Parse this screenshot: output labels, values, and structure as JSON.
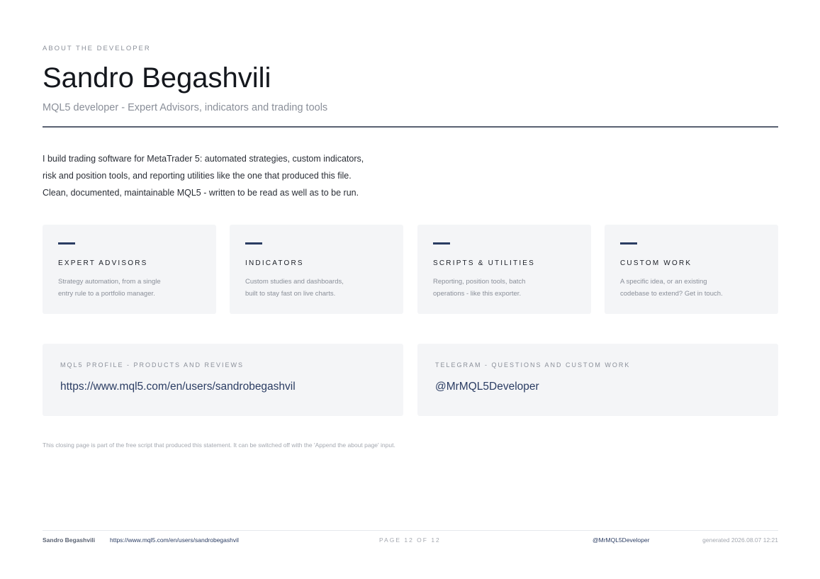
{
  "header": {
    "eyebrow": "ABOUT THE DEVELOPER",
    "name": "Sandro Begashvili",
    "tagline": "MQL5 developer - Expert Advisors, indicators and trading tools"
  },
  "intro": {
    "lines": [
      "I build trading software for MetaTrader 5: automated strategies, custom indicators,",
      "risk and position tools, and reporting utilities like the one that produced this file.",
      "Clean, documented, maintainable MQL5 - written to be read as well as to be run."
    ]
  },
  "cards": [
    {
      "title": "EXPERT ADVISORS",
      "desc_lines": [
        "Strategy automation, from a single",
        "entry rule to a portfolio manager."
      ]
    },
    {
      "title": "INDICATORS",
      "desc_lines": [
        "Custom studies and dashboards,",
        "built to stay fast on live charts."
      ]
    },
    {
      "title": "SCRIPTS & UTILITIES",
      "desc_lines": [
        "Reporting, position tools, batch",
        "operations - like this exporter."
      ]
    },
    {
      "title": "CUSTOM WORK",
      "desc_lines": [
        "A specific idea, or an existing",
        "codebase to extend? Get in touch."
      ]
    }
  ],
  "contacts": [
    {
      "label": "MQL5 PROFILE - PRODUCTS AND REVIEWS",
      "value": "https://www.mql5.com/en/users/sandrobegashvil"
    },
    {
      "label": "TELEGRAM - QUESTIONS AND CUSTOM WORK",
      "value": "@MrMQL5Developer"
    }
  ],
  "note": "This closing page is part of the free script that produced this statement. It can be switched off with the 'Append the about page' input.",
  "footer": {
    "name": "Sandro Begashvili",
    "url": "https://www.mql5.com/en/users/sandrobegashvil",
    "page": "PAGE 12 OF 12",
    "telegram": "@MrMQL5Developer",
    "generated": "generated 2026.08.07 12:21"
  },
  "colors": {
    "accent": "#2b3d63",
    "card_bg": "#f4f5f7",
    "muted": "#8a8f99",
    "rule": "#5a6272"
  }
}
